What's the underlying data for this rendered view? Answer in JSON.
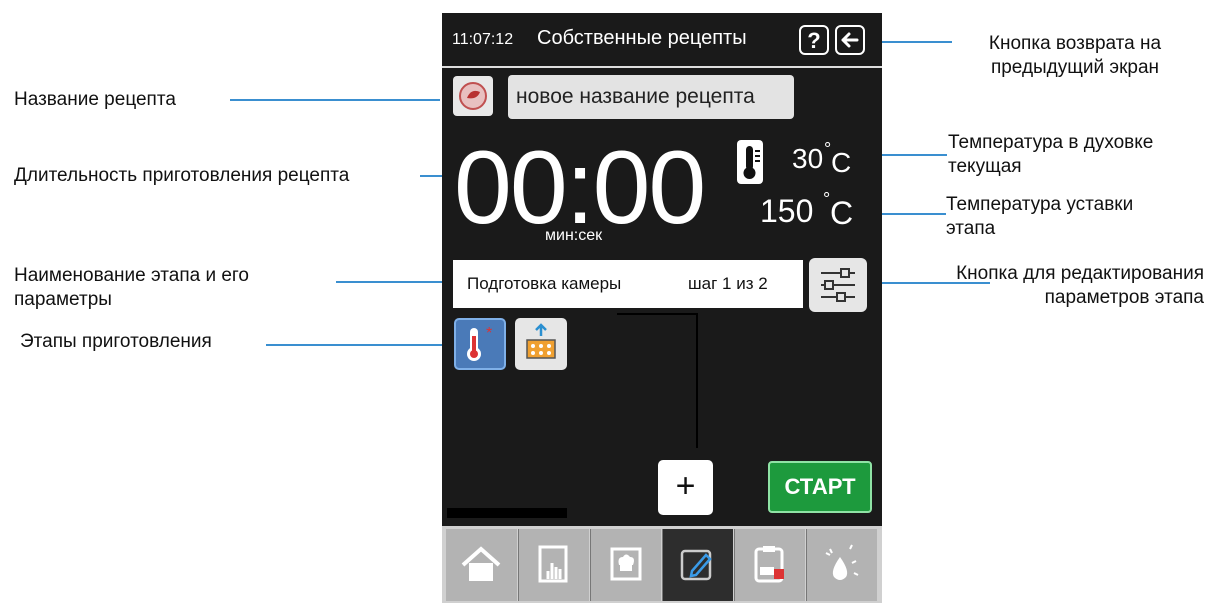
{
  "screen": {
    "time": "11:07:12",
    "title": "Собственные рецепты",
    "help_label": "?",
    "recipe_name": "новое название рецепта",
    "timer": "00:00",
    "timer_units": "мин:сек",
    "current_temp": "30",
    "set_temp": "150",
    "degree_symbol": "°",
    "temp_unit": "C",
    "stage_name": "Подготовка камеры",
    "stage_step": "шаг 1 из 2",
    "add_label": "+",
    "start_label": "СТАРТ",
    "tabs": [
      "home-icon",
      "touch-icon",
      "chef-book-icon",
      "edit-icon",
      "clipboard-icon",
      "cleaning-icon"
    ],
    "active_tab": 3
  },
  "annotations": {
    "back_button": "Кнопка возврата на предыдущий экран",
    "recipe_name": "Название рецепта",
    "current_temp": "Температура в духовке текущая",
    "duration": "Длительность приготовления рецепта",
    "set_temp": "Температура уставки этапа",
    "stage_name": "Наименование этапа и его параметры",
    "edit_stage": "Кнопка для редактирования параметров этапа",
    "stages": "Этапы приготовления"
  },
  "colors": {
    "screen_bg": "#1a1a1a",
    "leader_line": "#3a8fd0",
    "start_button": "#1d9a3d",
    "stage_tile_active": "#4a7ab8"
  }
}
